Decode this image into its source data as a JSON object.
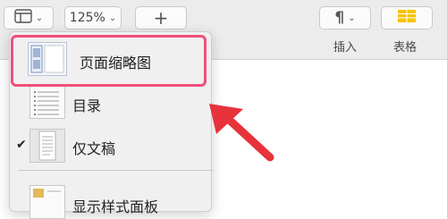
{
  "toolbar": {
    "zoom": "125%",
    "add_icon": "plus-icon",
    "sidebar_icon": "sidebar-icon",
    "insert_icon": "paragraph-icon",
    "insert_label": "插入",
    "table_label": "表格",
    "accent": "#f5c400"
  },
  "menu": {
    "items": [
      {
        "label": "页面缩略图",
        "icon": "page-thumbnails-icon",
        "highlighted": true
      },
      {
        "label": "目录",
        "icon": "table-of-contents-icon"
      },
      {
        "label": "仅文稿",
        "icon": "document-only-icon",
        "checked": true
      },
      {
        "label": "显示样式面板",
        "icon": "styles-panel-icon"
      }
    ],
    "highlight_color": "#f0507a",
    "arrow_color": "#e8323c"
  }
}
